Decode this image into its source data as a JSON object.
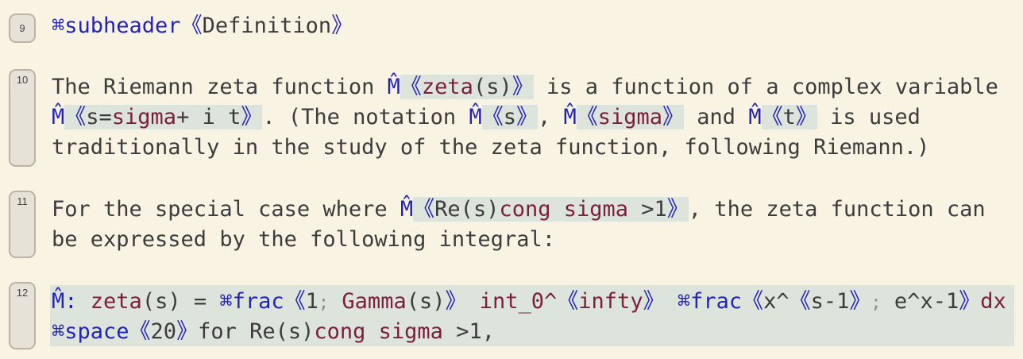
{
  "cells": [
    {
      "number": "9",
      "lines": [
        {
          "segments": [
            "⌘subheader",
            "《",
            "Definition",
            "》"
          ]
        }
      ]
    },
    {
      "number": "10",
      "lines": [
        {
          "segments": [
            "The Riemann zeta function ",
            "M̂",
            "《",
            "zeta",
            "(s)",
            "》",
            " is a function of a complex variable"
          ]
        },
        {
          "segments": [
            "M̂",
            "《",
            "s=",
            "sigma",
            "+ i t",
            "》",
            ". (The notation ",
            "M̂",
            "《",
            "s",
            "》",
            ", ",
            "M̂",
            "《",
            "sigma",
            "》",
            " and ",
            "M̂",
            "《",
            "t",
            "》",
            " is used"
          ]
        },
        {
          "segments": [
            "traditionally in the study of the zeta function, following Riemann.)"
          ]
        }
      ]
    },
    {
      "number": "11",
      "lines": [
        {
          "segments": [
            "For the special case where ",
            "M̂",
            "《",
            "Re(s)",
            "cong sigma",
            " >1",
            "》",
            ", the zeta function can"
          ]
        },
        {
          "segments": [
            "be expressed by the following integral:"
          ]
        }
      ]
    },
    {
      "number": "12",
      "lines": [
        {
          "segments": [
            "M̂: ",
            "zeta",
            "(s) = ",
            "⌘frac",
            "《",
            "1",
            ";",
            " ",
            "Gamma",
            "(s)",
            "》",
            " ",
            "int_0^",
            "《",
            "infty",
            "》",
            " ",
            "⌘frac",
            "《",
            "x^",
            "《",
            "s-1",
            "》",
            ";",
            " e^x-1",
            "》",
            "dx"
          ]
        },
        {
          "segments": [
            "⌘space",
            "《",
            "20",
            "》",
            "for Re(s)",
            "cong sigma",
            " >1,"
          ]
        }
      ]
    }
  ]
}
